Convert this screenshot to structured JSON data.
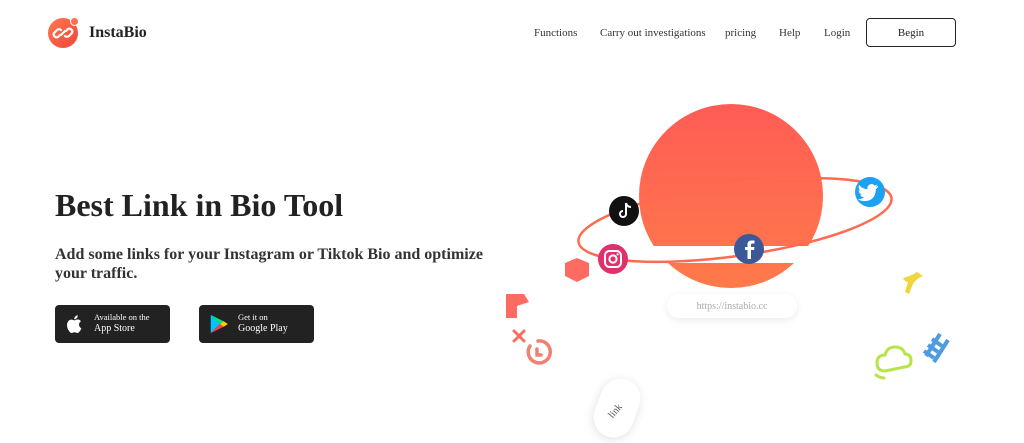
{
  "brand": {
    "name": "InstaBio"
  },
  "nav": {
    "functions": "Functions",
    "investigations": "Carry out investigations",
    "pricing": "pricing",
    "help": "Help",
    "login": "Login",
    "begin": "Begin"
  },
  "hero": {
    "title": "Best Link in Bio Tool",
    "subtitle": "Add some links for your Instagram or Tiktok Bio and optimize your traffic."
  },
  "stores": {
    "apple": {
      "small": "Available on the",
      "big": "App Store"
    },
    "google": {
      "small": "Get it on",
      "big": "Google Play"
    }
  },
  "illustration": {
    "url": "https://instabio.cc",
    "link_text": "link",
    "icons": [
      "tiktok-icon",
      "instagram-icon",
      "facebook-icon",
      "twitter-icon"
    ]
  },
  "colors": {
    "accent": "#ff5e4f",
    "dark_button": "#222222",
    "twitter": "#1da1f2",
    "facebook": "#3b5998"
  }
}
